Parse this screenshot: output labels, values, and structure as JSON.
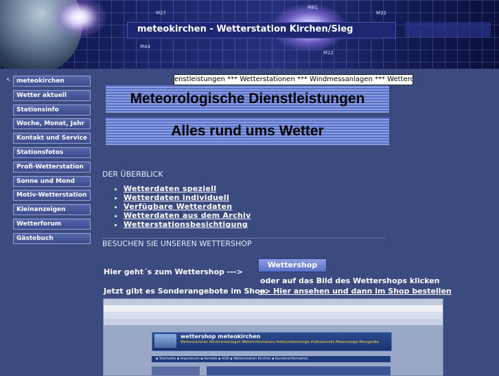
{
  "banner": {
    "title": "meteokirchen - Wetterstation Kirchen/Sieg",
    "labels": {
      "m27": "M27",
      "m81": "M81",
      "m32": "M32",
      "m44": "M44",
      "m12": "M12"
    }
  },
  "nav": {
    "items": [
      "meteokirchen",
      "Wetter aktuell",
      "Stationsinfo",
      "Woche, Monat, Jahr",
      "Kontakt und Service",
      "Stationsfotos",
      "Profi-Wetterstation",
      "Sonne und Mond",
      "Motiv-Wetterstation",
      "Kleinanzeigen",
      "Wetterforum",
      "Gästebuch"
    ]
  },
  "ticker": "enstleistungen *** Wetterstationen *** Windmessanlagen *** Wetterd",
  "headers": {
    "line1": "Meteorologische Dienstleistungen",
    "line2": "Alles rund ums Wetter"
  },
  "overview": {
    "heading": "DER ÜBERBLICK",
    "links": [
      "Wetterdaten speziell",
      "Wetterdaten individuell",
      "Verfügbare Wetterdaten",
      "Wetterdaten aus dem Archiv",
      "Wetterstationsbesichtigung"
    ]
  },
  "shop": {
    "heading": "BESUCHEN SIE UNSEREN WETTERSHOP",
    "here_text": "Hier geht´s zum Wettershop --->",
    "button_label": "Wettershop",
    "or_text": "oder auf das Bild des Wettershops klicken",
    "offer_text": "Jetzt gibt es Sonderangebote im Shop.",
    "offer_link": "--> Hier ansehen und dann im Shop bestellen"
  },
  "shop_screenshot": {
    "title": "wettershop meteokirchen",
    "subtitle": "Wetterstationen Windmessanlagen Wetterinformations Hobbymeteorologie Professionelle Meteorologie Messgeräte",
    "nav": "▪ Startseite  ▪ Impressum  ▪ Kontakt  ▪ AGB  ▪ Wetterstation Kirchen  ▪ Kundeninformation"
  }
}
